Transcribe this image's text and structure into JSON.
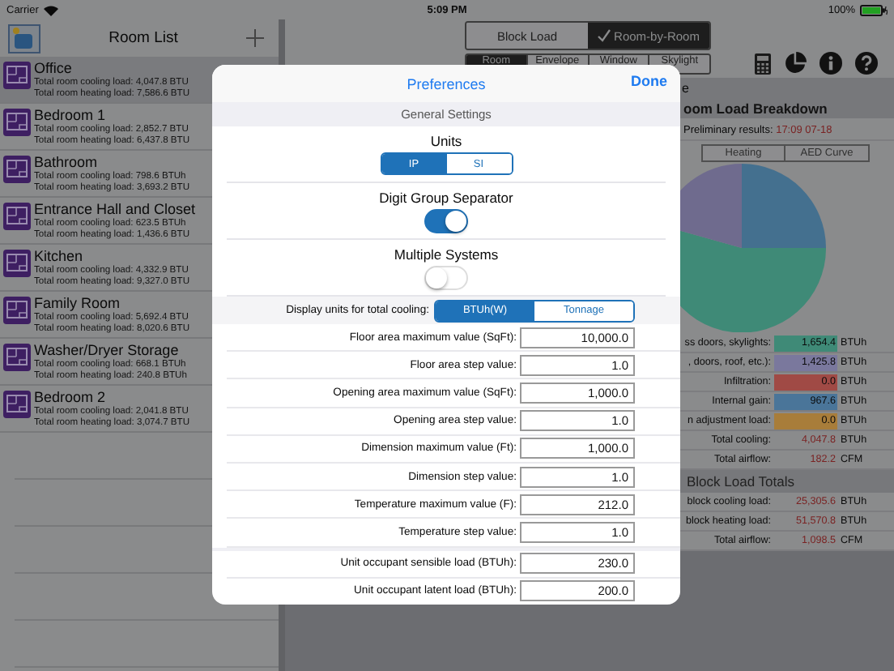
{
  "status_bar": {
    "carrier": "Carrier",
    "time": "5:09 PM",
    "battery": "100%"
  },
  "room_list": {
    "title": "Room List",
    "rooms": [
      {
        "name": "Office",
        "cooling": "Total room cooling load: 4,047.8 BTU",
        "heating": "Total room heating load: 7,586.6 BTU",
        "selected": true
      },
      {
        "name": "Bedroom 1",
        "cooling": "Total room cooling load: 2,852.7 BTU",
        "heating": "Total room heating load: 6,437.8 BTU",
        "selected": false
      },
      {
        "name": "Bathroom",
        "cooling": "Total room cooling load: 798.6 BTUh",
        "heating": "Total room heating load: 3,693.2 BTU",
        "selected": false
      },
      {
        "name": "Entrance Hall and Closet",
        "cooling": "Total room cooling load: 623.5 BTUh",
        "heating": "Total room heating load: 1,436.6 BTU",
        "selected": false
      },
      {
        "name": "Kitchen",
        "cooling": "Total room cooling load: 4,332.9 BTU",
        "heating": "Total room heating load: 9,327.0 BTU",
        "selected": false
      },
      {
        "name": "Family Room",
        "cooling": "Total room cooling load: 5,692.4 BTU",
        "heating": "Total room heating load: 8,020.6 BTU",
        "selected": false
      },
      {
        "name": "Washer/Dryer Storage",
        "cooling": "Total room cooling load: 668.1 BTUh",
        "heating": "Total room heating load: 240.8 BTUh",
        "selected": false
      },
      {
        "name": "Bedroom 2",
        "cooling": "Total room cooling load: 2,041.8 BTU",
        "heating": "Total room heating load: 3,074.7 BTU",
        "selected": false
      }
    ]
  },
  "main": {
    "modes": [
      {
        "label": "Block Load",
        "selected": false
      },
      {
        "label": "Room-by-Room",
        "selected": true
      }
    ],
    "tabs": [
      {
        "label": "Room",
        "selected": true
      },
      {
        "label": "Envelope",
        "selected": false
      },
      {
        "label": "Window",
        "selected": false
      },
      {
        "label": "Skylight",
        "selected": false
      }
    ],
    "section_title": "e",
    "breakdown_title": "oom Load Breakdown",
    "prelim_label": "Preliminary results:",
    "prelim_time": "17:09 07-18",
    "chart_tabs": [
      {
        "label": "Heating",
        "selected": false
      },
      {
        "label": "AED Curve",
        "selected": false
      }
    ],
    "legend": [
      {
        "label": "ss doors, skylights:",
        "value": "1,654.4",
        "unit": "BTUh",
        "color": "#3f8a77"
      },
      {
        "label": ", doors, roof, etc.):",
        "value": "1,425.8",
        "unit": "BTUh",
        "color": "#7a789d"
      },
      {
        "label": "Infiltration:",
        "value": "0.0",
        "unit": "BTUh",
        "color": "#a04a45"
      },
      {
        "label": "Internal gain:",
        "value": "967.6",
        "unit": "BTUh",
        "color": "#4a7599"
      },
      {
        "label": "n adjustment load:",
        "value": "0.0",
        "unit": "BTUh",
        "color": "#a87d3a"
      }
    ],
    "totals": [
      {
        "label": "Total cooling:",
        "value": "4,047.8",
        "unit": "BTUh"
      },
      {
        "label": "Total airflow:",
        "value": "182.2",
        "unit": "CFM"
      }
    ],
    "block_title": "Block Load Totals",
    "block_totals": [
      {
        "label": "block cooling load:",
        "value": "25,305.6",
        "unit": "BTUh"
      },
      {
        "label": "block heating load:",
        "value": "51,570.8",
        "unit": "BTUh"
      },
      {
        "label": "Total airflow:",
        "value": "1,098.5",
        "unit": "CFM"
      }
    ]
  },
  "modal": {
    "title": "Preferences",
    "done": "Done",
    "section": "General Settings",
    "units": {
      "label": "Units",
      "options": [
        {
          "label": "IP",
          "selected": true
        },
        {
          "label": "SI",
          "selected": false
        }
      ]
    },
    "toggles": [
      {
        "label": "Digit Group Separator",
        "on": true
      },
      {
        "label": "Multiple Systems",
        "on": false
      }
    ],
    "cooling_units": {
      "label": "Display units for total cooling:",
      "options": [
        {
          "label": "BTUh(W)",
          "selected": true
        },
        {
          "label": "Tonnage",
          "selected": false
        }
      ]
    },
    "field_groups": [
      [
        {
          "label": "Floor area maximum value (SqFt):",
          "value": "10,000.0"
        },
        {
          "label": "Floor area step value:",
          "value": "1.0"
        },
        {
          "label": "Opening area maximum value (SqFt):",
          "value": "1,000.0"
        },
        {
          "label": "Opening area step value:",
          "value": "1.0"
        },
        {
          "label": "Dimension maximum value (Ft):",
          "value": "1,000.0"
        },
        {
          "label": "Dimension step value:",
          "value": "1.0"
        },
        {
          "label": "Temperature maximum value (F):",
          "value": "212.0"
        },
        {
          "label": "Temperature step value:",
          "value": "1.0"
        }
      ],
      [
        {
          "label": "Unit occupant sensible load (BTUh):",
          "value": "230.0"
        },
        {
          "label": "Unit occupant latent load (BTUh):",
          "value": "200.0"
        }
      ]
    ]
  }
}
